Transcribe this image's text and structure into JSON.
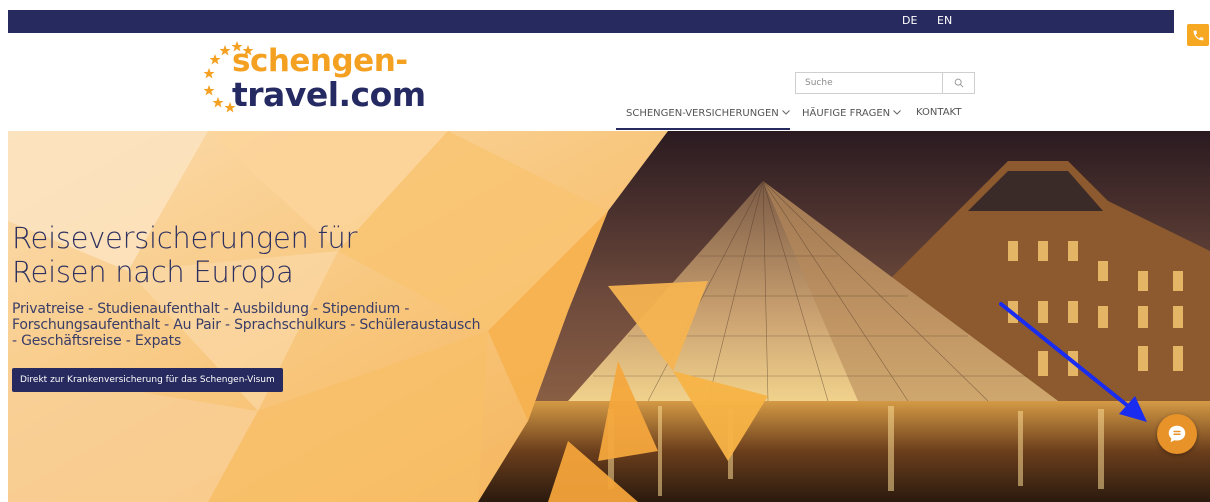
{
  "topbar": {
    "languages": [
      "DE",
      "EN"
    ],
    "phone_icon": "phone-icon"
  },
  "logo": {
    "line1": "schengen-",
    "line2": "travel.com",
    "colors": {
      "orange": "#f4a021",
      "navy": "#262a62"
    }
  },
  "search": {
    "placeholder": "Suche",
    "icon": "search-icon"
  },
  "nav": {
    "items": [
      {
        "label": "SCHENGEN-VERSICHERUNGEN",
        "has_dropdown": true
      },
      {
        "label": "HÄUFIGE FRAGEN",
        "has_dropdown": true
      },
      {
        "label": "KONTAKT",
        "has_dropdown": false
      }
    ]
  },
  "hero": {
    "title_line1": "Reiseversicherungen für",
    "title_line2": "Reisen nach Europa",
    "subtitle": "Privatreise - Studienaufenthalt - Ausbildung - Stipendium - Forschungsaufenthalt - Au Pair - Sprachschulkurs - Schüleraustausch - Geschäftsreise - Expats",
    "cta_label": "Direkt zur Krankenversicherung für das Schengen-Visum"
  },
  "chat": {
    "icon": "chat-icon"
  },
  "theme": {
    "navy": "#272a5e",
    "orange": "#f7a823"
  }
}
